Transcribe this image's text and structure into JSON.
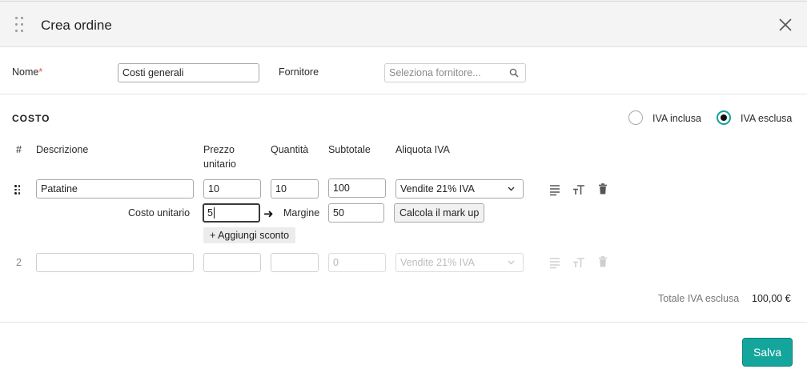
{
  "dialog": {
    "title": "Crea ordine",
    "close_icon": "close-icon",
    "drag_icon": "drag-handle-icon"
  },
  "form": {
    "name_label": "Nome",
    "name_required": "*",
    "name_value": "Costi generali",
    "supplier_label": "Fornitore",
    "supplier_placeholder": "Seleziona fornitore...",
    "supplier_icon": "search-icon"
  },
  "cost": {
    "section_title": "COSTO",
    "vat_included_label": "IVA inclusa",
    "vat_excluded_label": "IVA esclusa",
    "vat_selected": "IVA esclusa",
    "accent_color": "#14a69c"
  },
  "table": {
    "headers": {
      "index": "#",
      "description": "Descrizione",
      "unit_price_line1": "Prezzo",
      "unit_price_line2": "unitario",
      "quantity": "Quantità",
      "subtotal": "Subtotale",
      "vat_rate": "Aliquota IVA"
    },
    "rows": [
      {
        "handle_icon": "grip-icon",
        "description": "Patatine",
        "unit_price": "10",
        "quantity": "10",
        "subtotal": "100",
        "vat_rate": "Vendite 21% IVA",
        "unit_cost_label": "Costo unitario",
        "unit_cost_value": "5",
        "margin_label": "Margine",
        "margin_value": "50",
        "markup_button": "Calcola il mark up",
        "discount_button": "+ Aggiungi sconto"
      },
      {
        "index": "2",
        "description": "",
        "unit_price": "",
        "quantity": "",
        "subtotal_placeholder": "0",
        "vat_rate": "Vendite 21% IVA"
      }
    ]
  },
  "totals": {
    "label": "Totale IVA esclusa",
    "value": "100,00 €"
  },
  "footer": {
    "save_label": "Salva"
  }
}
